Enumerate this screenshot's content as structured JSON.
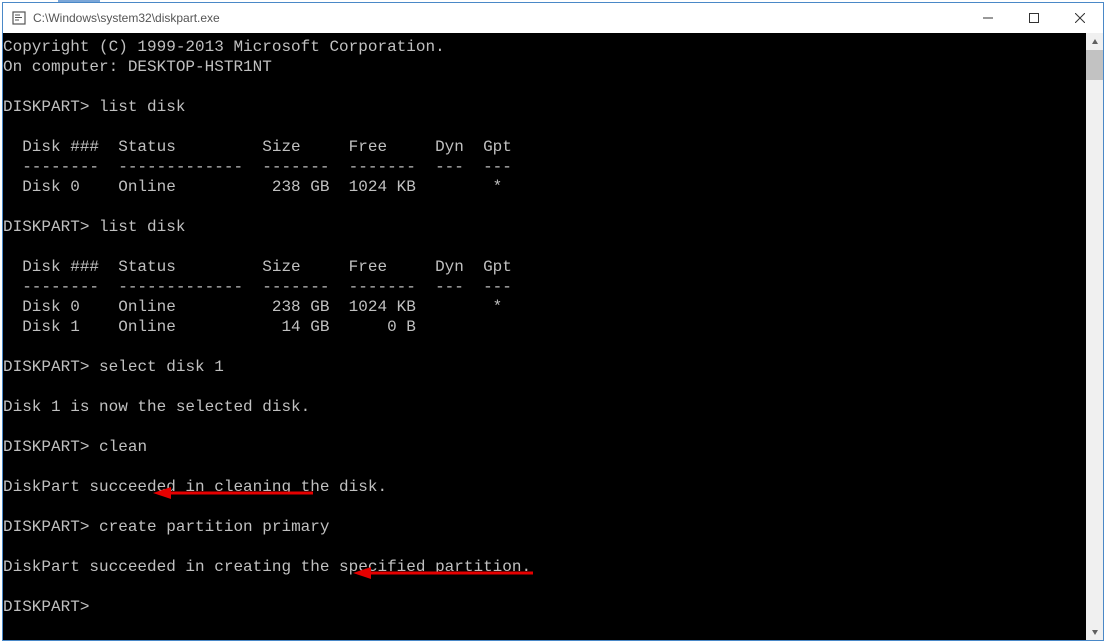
{
  "window": {
    "title": "C:\\Windows\\system32\\diskpart.exe",
    "minimize_tip": "Minimize",
    "maximize_tip": "Maximize",
    "close_tip": "Close"
  },
  "terminal": {
    "copyright": "Copyright (C) 1999-2013 Microsoft Corporation.",
    "on_computer": "On computer: DESKTOP-HSTR1NT",
    "prompt": "DISKPART>",
    "cmd_list1": "list disk",
    "hdr": "  Disk ###  Status         Size     Free     Dyn  Gpt",
    "sep": "  --------  -------------  -------  -------  ---  ---",
    "row_d0": "  Disk 0    Online          238 GB  1024 KB        *",
    "cmd_list2": "list disk",
    "row_d0b": "  Disk 0    Online          238 GB  1024 KB        *",
    "row_d1": "  Disk 1    Online           14 GB      0 B",
    "cmd_select": "select disk 1",
    "msg_selected": "Disk 1 is now the selected disk.",
    "cmd_clean": "clean",
    "msg_clean": "DiskPart succeeded in cleaning the disk.",
    "cmd_create": "create partition primary",
    "msg_create": "DiskPart succeeded in creating the specified partition."
  }
}
